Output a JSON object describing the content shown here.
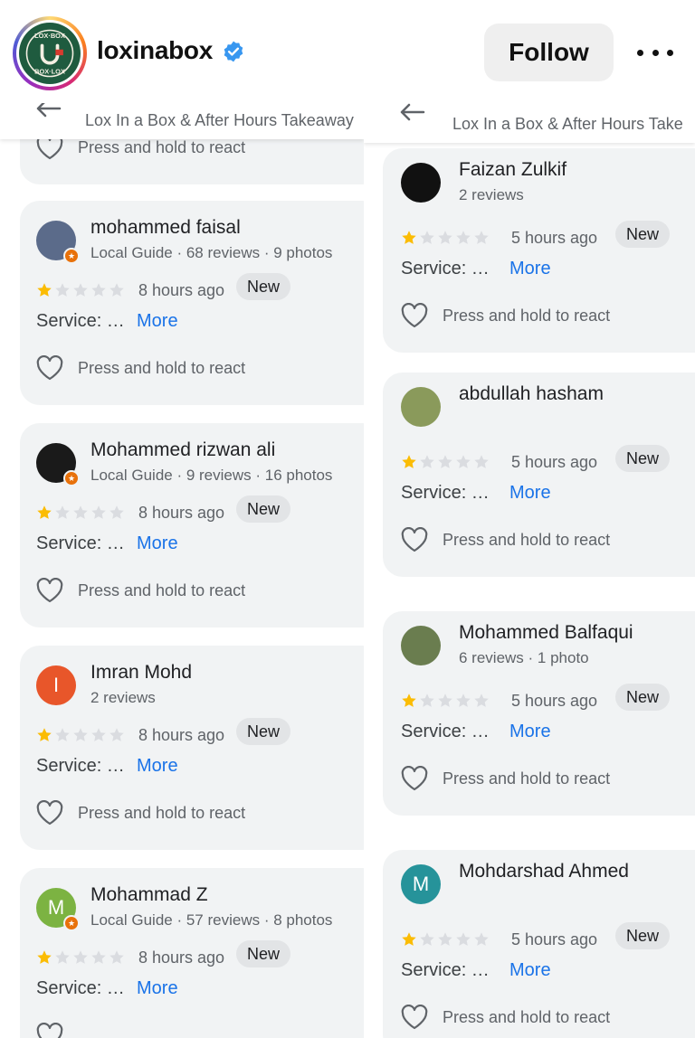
{
  "header": {
    "username": "loxinabox",
    "follow_label": "Follow",
    "logo_text": "LOX IN A BOX"
  },
  "left_panel": {
    "place_name": "Lox In a Box & After Hours Takeaway",
    "top_partial": {
      "react_text": "Press and hold to react"
    },
    "reviews": [
      {
        "name": "mohammed faisal",
        "meta": "Local Guide · 68 reviews · 9 photos",
        "rating": 1,
        "time": "8 hours ago",
        "badge": "New",
        "service": "Service: …",
        "more": "More",
        "react": "Press and hold to react",
        "avatar_color": "#5b6b8a",
        "avatar_letter": "",
        "guide": true
      },
      {
        "name": "Mohammed rizwan ali",
        "meta": "Local Guide · 9 reviews · 16 photos",
        "rating": 1,
        "time": "8 hours ago",
        "badge": "New",
        "service": "Service: …",
        "more": "More",
        "react": "Press and hold to react",
        "avatar_color": "#1a1a1a",
        "avatar_letter": "",
        "guide": true
      },
      {
        "name": "Imran Mohd",
        "meta": "2 reviews",
        "rating": 1,
        "time": "8 hours ago",
        "badge": "New",
        "service": "Service: …",
        "more": "More",
        "react": "Press and hold to react",
        "avatar_color": "#e8562a",
        "avatar_letter": "I",
        "guide": false
      },
      {
        "name": "Mohammad Z",
        "meta": "Local Guide · 57 reviews · 8 photos",
        "rating": 1,
        "time": "8 hours ago",
        "badge": "New",
        "service": "Service: …",
        "more": "More",
        "react": "",
        "avatar_color": "#7cb342",
        "avatar_letter": "M",
        "guide": true
      }
    ]
  },
  "right_panel": {
    "place_name": "Lox In a Box & After Hours Take",
    "reviews": [
      {
        "name": "Faizan Zulkif",
        "meta": "2 reviews",
        "rating": 1,
        "time": "5 hours ago",
        "badge": "New",
        "service": "Service: …",
        "more": "More",
        "react": "Press and hold to react",
        "avatar_color": "#111111",
        "avatar_letter": "",
        "guide": false
      },
      {
        "name": "abdullah hasham",
        "meta": "",
        "rating": 1,
        "time": "5 hours ago",
        "badge": "New",
        "service": "Service: …",
        "more": "More",
        "react": "Press and hold to react",
        "avatar_color": "#8a9a5b",
        "avatar_letter": "",
        "guide": false
      },
      {
        "name": "Mohammed Balfaqui",
        "meta": "6 reviews · 1 photo",
        "rating": 1,
        "time": "5 hours ago",
        "badge": "New",
        "service": "Service: …",
        "more": "More",
        "react": "Press and hold to react",
        "avatar_color": "#6a7d4f",
        "avatar_letter": "",
        "guide": false
      },
      {
        "name": "Mohdarshad Ahmed",
        "meta": "",
        "rating": 1,
        "time": "5 hours ago",
        "badge": "New",
        "service": "Service: …",
        "more": "More",
        "react": "Press and hold to react",
        "avatar_color": "#26939a",
        "avatar_letter": "M",
        "guide": false
      }
    ]
  },
  "colors": {
    "star_on": "#fbbc04",
    "star_off": "#dadce0",
    "link": "#1a73e8",
    "verified": "#3897f0"
  },
  "icons": [
    "verified-icon",
    "more-options-icon",
    "back-arrow-icon",
    "star-icon",
    "heart-outline-icon",
    "local-guide-badge-icon"
  ]
}
